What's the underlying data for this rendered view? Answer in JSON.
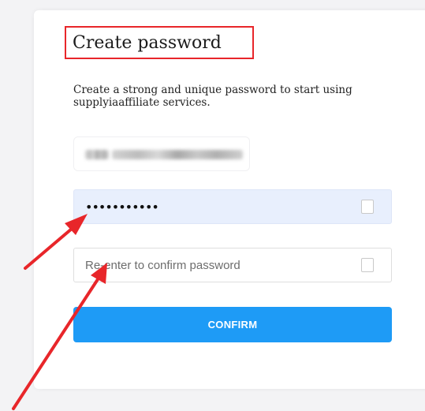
{
  "page": {
    "title": "Create password",
    "description": "Create a strong and unique password to start using supplyiaaffiliate services."
  },
  "form": {
    "email_value": "",
    "password_value": "•••••••••••",
    "confirm_placeholder": "Re-enter to confirm password",
    "confirm_label": "CONFIRM"
  },
  "colors": {
    "accent": "#1e9bf6",
    "annotation": "#e8262a",
    "password_bg": "#e8effd"
  },
  "icons": {
    "password_toggle": "checkbox-toggle-icon",
    "confirm_toggle": "checkbox-toggle-icon"
  }
}
